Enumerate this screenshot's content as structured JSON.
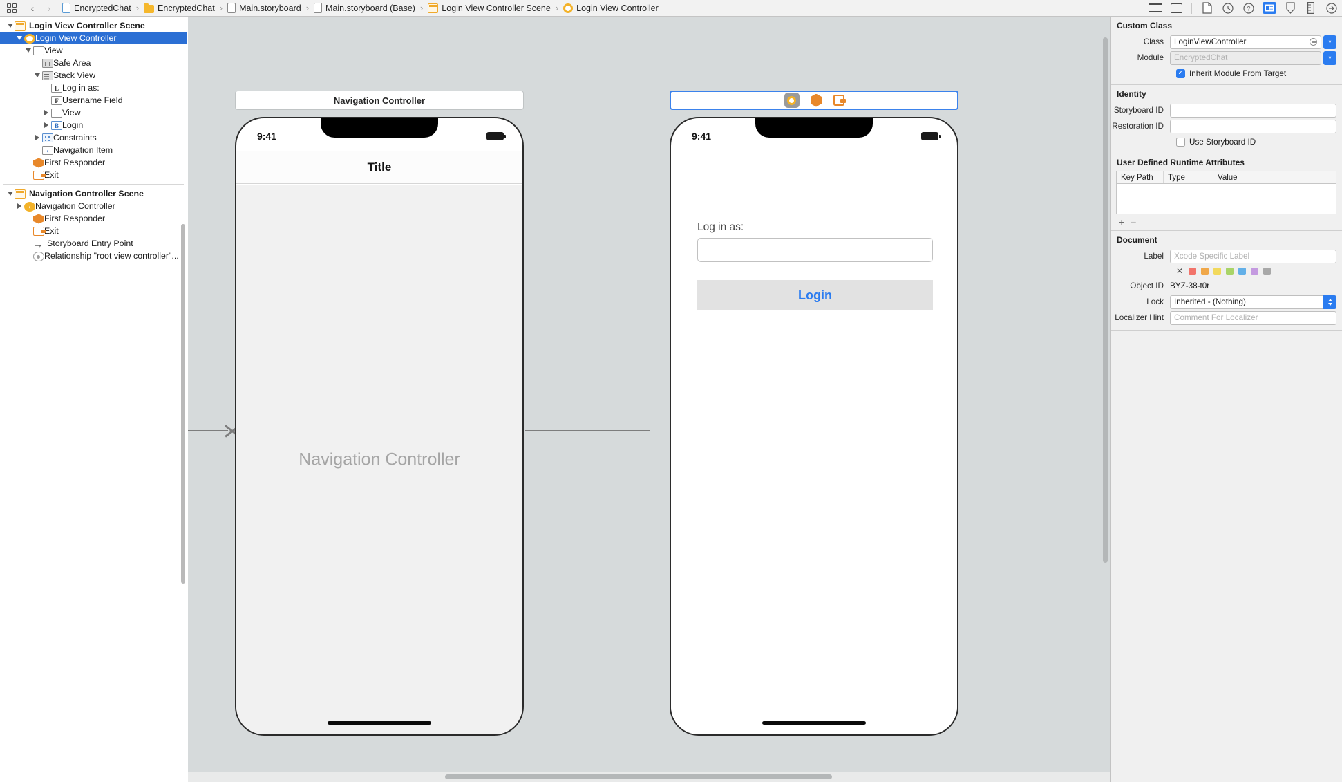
{
  "topbar": {
    "grid_button": "grid-button",
    "back_arrow": "‹",
    "forward_arrow": "›",
    "breadcrumbs": [
      {
        "label": "EncryptedChat",
        "icon": "doc-blue-icon"
      },
      {
        "label": "EncryptedChat",
        "icon": "folder-icon"
      },
      {
        "label": "Main.storyboard",
        "icon": "doc-gray-icon"
      },
      {
        "label": "Main.storyboard (Base)",
        "icon": "doc-gray-icon"
      },
      {
        "label": "Login View Controller Scene",
        "icon": "scene-icon"
      },
      {
        "label": "Login View Controller",
        "icon": "view-controller-icon"
      }
    ],
    "right_icons": [
      {
        "name": "standard-editor-icon"
      },
      {
        "name": "assistant-editor-icon"
      },
      {
        "name": "file-inspector-icon"
      },
      {
        "name": "history-inspector-icon"
      },
      {
        "name": "quick-help-inspector-icon"
      },
      {
        "name": "identity-inspector-icon",
        "active": true
      },
      {
        "name": "attributes-inspector-icon"
      },
      {
        "name": "size-inspector-icon"
      },
      {
        "name": "connections-inspector-icon"
      }
    ]
  },
  "outline": {
    "items": [
      {
        "label": "Login View Controller Scene",
        "indent": 0,
        "disclosure": "down",
        "icon": "scene-icon",
        "bold": true,
        "selected": false
      },
      {
        "label": "Login View Controller",
        "indent": 1,
        "disclosure": "down",
        "icon": "view-controller-icon",
        "bold": false,
        "selected": true
      },
      {
        "label": "View",
        "indent": 2,
        "disclosure": "down",
        "icon": "view-icon",
        "bold": false,
        "selected": false
      },
      {
        "label": "Safe Area",
        "indent": 3,
        "disclosure": "none",
        "icon": "safe-area-icon",
        "bold": false,
        "selected": false
      },
      {
        "label": "Stack View",
        "indent": 3,
        "disclosure": "down",
        "icon": "stack-view-icon",
        "bold": false,
        "selected": false
      },
      {
        "label": "Log in as:",
        "indent": 4,
        "disclosure": "none",
        "icon": "label-icon",
        "bold": false,
        "selected": false
      },
      {
        "label": "Username Field",
        "indent": 4,
        "disclosure": "none",
        "icon": "textfield-icon",
        "bold": false,
        "selected": false
      },
      {
        "label": "View",
        "indent": 4,
        "disclosure": "right",
        "icon": "view-icon",
        "bold": false,
        "selected": false
      },
      {
        "label": "Login",
        "indent": 4,
        "disclosure": "right",
        "icon": "button-icon",
        "bold": false,
        "selected": false
      },
      {
        "label": "Constraints",
        "indent": 3,
        "disclosure": "right",
        "icon": "constraints-icon",
        "bold": false,
        "selected": false
      },
      {
        "label": "Navigation Item",
        "indent": 3,
        "disclosure": "none",
        "icon": "navigation-item-icon",
        "bold": false,
        "selected": false
      },
      {
        "label": "First Responder",
        "indent": 2,
        "disclosure": "none",
        "icon": "first-responder-icon",
        "bold": false,
        "selected": false
      },
      {
        "label": "Exit",
        "indent": 2,
        "disclosure": "none",
        "icon": "exit-icon",
        "bold": false,
        "selected": false
      }
    ],
    "items2": [
      {
        "label": "Navigation Controller Scene",
        "indent": 0,
        "disclosure": "down",
        "icon": "scene-icon",
        "bold": true,
        "selected": false
      },
      {
        "label": "Navigation Controller",
        "indent": 1,
        "disclosure": "right",
        "icon": "nav-controller-icon",
        "bold": false,
        "selected": false
      },
      {
        "label": "First Responder",
        "indent": 2,
        "disclosure": "none",
        "icon": "first-responder-icon",
        "bold": false,
        "selected": false
      },
      {
        "label": "Exit",
        "indent": 2,
        "disclosure": "none",
        "icon": "exit-icon",
        "bold": false,
        "selected": false
      },
      {
        "label": "Storyboard Entry Point",
        "indent": 2,
        "disclosure": "none",
        "icon": "entry-point-icon",
        "bold": false,
        "selected": false
      },
      {
        "label": "Relationship \"root view controller\"...",
        "indent": 2,
        "disclosure": "none",
        "icon": "relationship-icon",
        "bold": false,
        "selected": false
      }
    ]
  },
  "canvas": {
    "nav_scene": {
      "title_bar": "Navigation Controller",
      "status_time": "9:41",
      "navbar_title": "Title",
      "placeholder": "Navigation Controller"
    },
    "login_scene": {
      "status_time": "9:41",
      "icons": [
        "view-controller-icon",
        "first-responder-icon",
        "exit-icon"
      ],
      "form_label": "Log in as:",
      "field_value": "",
      "button_label": "Login"
    }
  },
  "inspector": {
    "custom_class": {
      "title": "Custom Class",
      "class_label": "Class",
      "class_value": "LoginViewController",
      "module_label": "Module",
      "module_placeholder": "EncryptedChat",
      "inherit_label": "Inherit Module From Target",
      "inherit_checked": true
    },
    "identity": {
      "title": "Identity",
      "storyboard_id_label": "Storyboard ID",
      "storyboard_id_value": "",
      "restoration_id_label": "Restoration ID",
      "restoration_id_value": "",
      "use_storyboard_id_label": "Use Storyboard ID",
      "use_storyboard_id_checked": false
    },
    "runtime_attributes": {
      "title": "User Defined Runtime Attributes",
      "columns": [
        "Key Path",
        "Type",
        "Value"
      ],
      "rows": [],
      "add_button": "+",
      "remove_button": "−"
    },
    "document": {
      "title": "Document",
      "label_label": "Label",
      "label_placeholder": "Xcode Specific Label",
      "swatch_colors": [
        "#f2746b",
        "#f0a84a",
        "#f2d95c",
        "#a9d468",
        "#63b0e8",
        "#c49ae0",
        "#a8a8a8"
      ],
      "object_id_label": "Object ID",
      "object_id_value": "BYZ-38-t0r",
      "lock_label": "Lock",
      "lock_value": "Inherited - (Nothing)",
      "localizer_hint_label": "Localizer Hint",
      "localizer_hint_placeholder": "Comment For Localizer"
    }
  }
}
